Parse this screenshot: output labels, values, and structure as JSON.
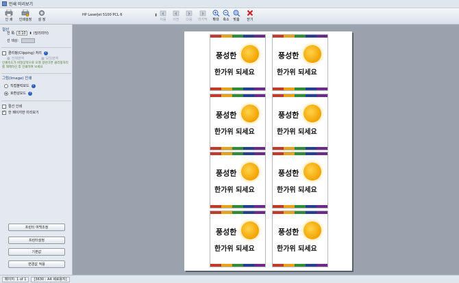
{
  "window": {
    "title": "인쇄 미리보기"
  },
  "toolbar": {
    "print_label": "인 쇄",
    "print_setup_label": "인쇄설정",
    "settings_label": "설 정",
    "printer_name": "HP LaserJet 5100 PCL 6",
    "first_label": "처음",
    "prev_label": "이전",
    "next_label": "다음",
    "last_label": "마지막",
    "zoom_in_label": "확대",
    "zoom_out_label": "축소",
    "fit_label": "맞춤",
    "close_label": "닫기"
  },
  "sidebar": {
    "cutline_title": "절선",
    "line_width_label": "선 폭:",
    "line_width_value": "0.10",
    "line_width_unit": "(밀리미터)",
    "line_color_label": "선 색상:",
    "clipping_label": "클리핑(Clipping) 처리",
    "clip_option1": "전체영역",
    "clip_option2": "보임영역",
    "clipping_note": "인쇄속도가 비정상적으로 오래 걸린다면 클리핑처리를 해제하신 후 인쇄하여 보세요",
    "image_print_title": "그림(Image) 인쇄",
    "image_mode1": "직접블럭모드",
    "image_mode2": "호환성모드",
    "cutline_print_label": "절선 인쇄",
    "one_page_preview_label": "한 페이지만 미리보기",
    "btn_margin": "프린터 여백조정",
    "btn_printer_settings": "프린터설정",
    "btn_default": "기본값",
    "btn_apply": "변경값 적용"
  },
  "card": {
    "line1": "풍성한",
    "line2": "한가위 되세요",
    "stripe_colors": [
      "#c0392b",
      "#e8a215",
      "#2e8b3a",
      "#243f8f",
      "#6a2a86"
    ]
  },
  "status": {
    "page_info": "페이지: 1 of 1",
    "paper_info": "[3630 : A4 세로용지]"
  }
}
